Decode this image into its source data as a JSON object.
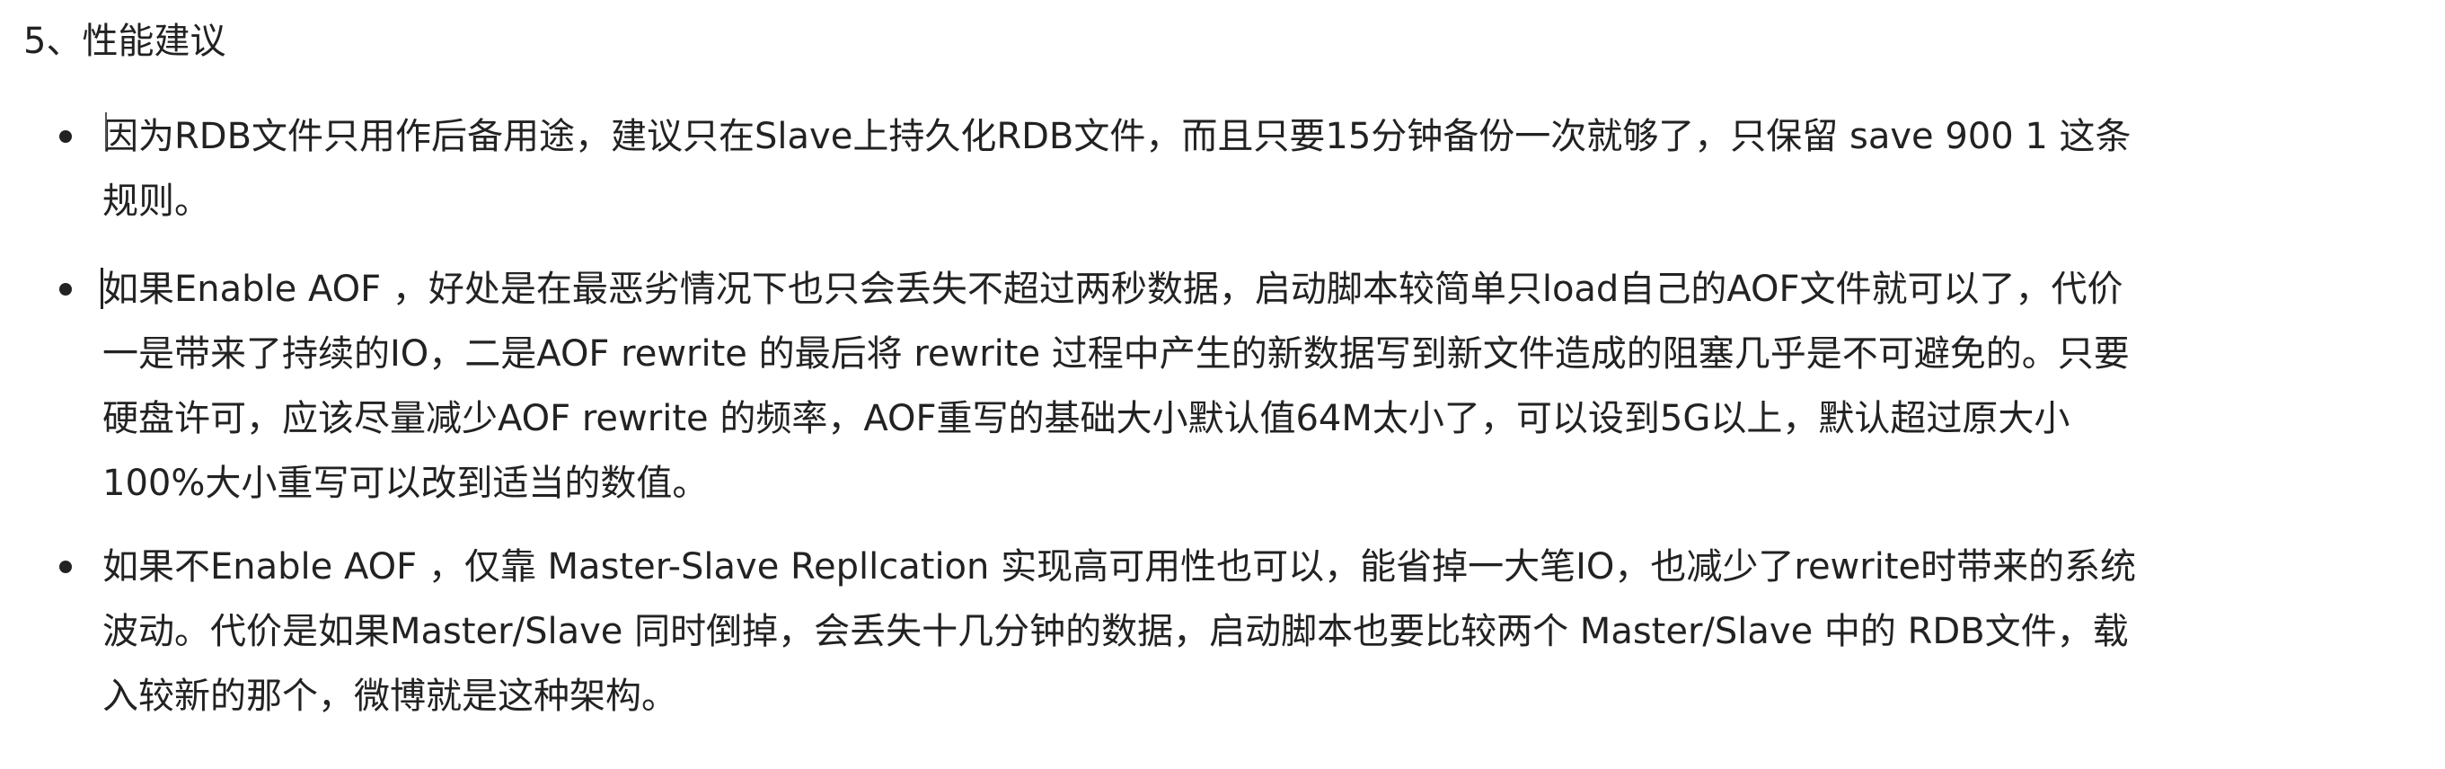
{
  "section": {
    "heading": "5、性能建议"
  },
  "items": [
    {
      "lines": [
        "因为RDB文件只用作后备用途，建议只在Slave上持久化RDB文件，而且只要15分钟备份一次就够了，只保留 save 900 1 这条",
        "规则。"
      ]
    },
    {
      "lines": [
        "如果Enable AOF ，好处是在最恶劣情况下也只会丢失不超过两秒数据，启动脚本较简单只load自己的AOF文件就可以了，代价",
        "一是带来了持续的IO，二是AOF rewrite 的最后将 rewrite 过程中产生的新数据写到新文件造成的阻塞几乎是不可避免的。只要",
        "硬盘许可，应该尽量减少AOF rewrite 的频率，AOF重写的基础大小默认值64M太小了，可以设到5G以上，默认超过原大小",
        "100%大小重写可以改到适当的数值。"
      ]
    },
    {
      "lines": [
        "如果不Enable AOF ，仅靠 Master-Slave Repllcation 实现高可用性也可以，能省掉一大笔IO，也减少了rewrite时带来的系统",
        "波动。代价是如果Master/Slave 同时倒掉，会丢失十几分钟的数据，启动脚本也要比较两个 Master/Slave 中的 RDB文件，载",
        "入较新的那个，微博就是这种架构。"
      ]
    }
  ]
}
